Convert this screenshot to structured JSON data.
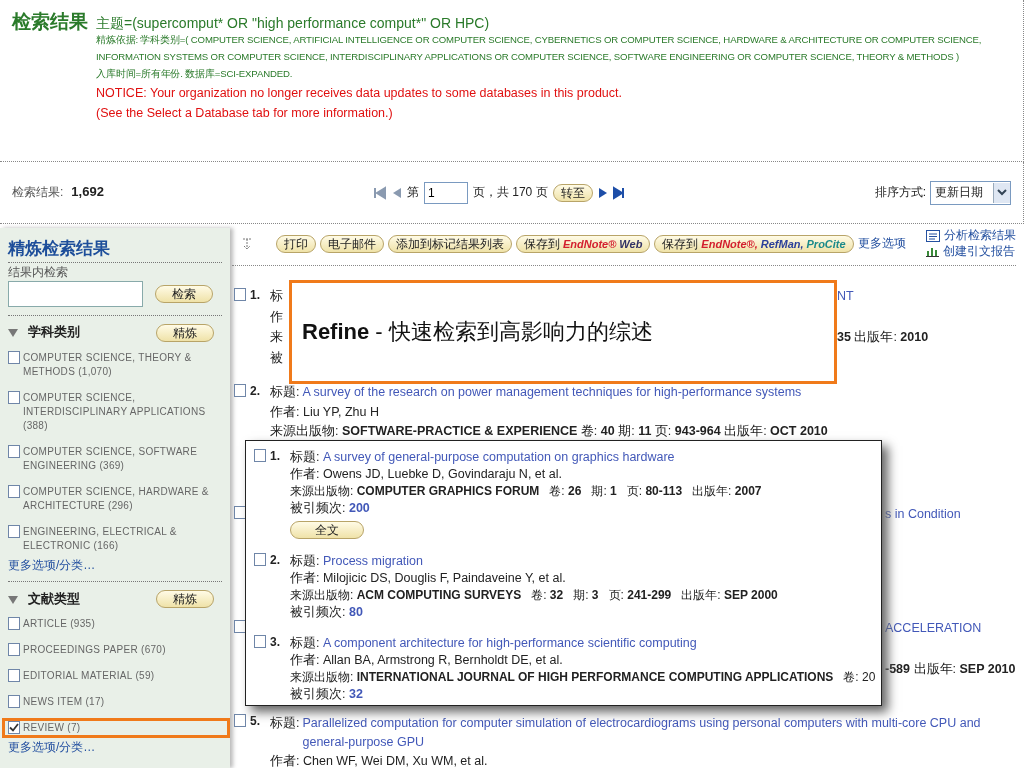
{
  "header": {
    "title": "检索结果",
    "query": "主题=(supercomput* OR \"high performance comput*\" OR HPC)",
    "refine_by": "精炼依据: 学科类别=( COMPUTER SCIENCE, ARTIFICIAL INTELLIGENCE OR COMPUTER SCIENCE, CYBERNETICS OR COMPUTER SCIENCE, HARDWARE & ARCHITECTURE OR COMPUTER SCIENCE, INFORMATION SYSTEMS OR COMPUTER SCIENCE, INTERDISCIPLINARY APPLICATIONS OR COMPUTER SCIENCE, SOFTWARE ENGINEERING OR COMPUTER SCIENCE, THEORY & METHODS )",
    "timespan": "入库时间=所有年份. 数据库=SCI-EXPANDED.",
    "notice": [
      "NOTICE: Your organization no longer receives data updates to some databases in this product.",
      "(See the Select a Database tab for more information.)"
    ]
  },
  "results_bar": {
    "label": "检索结果:",
    "count": "1,692",
    "page_prefix": "第",
    "page": "1",
    "page_suffix": "页，共 170 页",
    "go_button": "转至",
    "sort_label": "排序方式:",
    "sort_value": "更新日期"
  },
  "toolbar": {
    "buttons": [
      {
        "label": "打印"
      },
      {
        "label": "电子邮件"
      },
      {
        "label": "添加到标记结果列表"
      },
      {
        "label": "保存到",
        "brand": [
          {
            "text": "EndNote®",
            "color": "#d3202f"
          },
          {
            "text": "Web",
            "color": "#333366"
          }
        ]
      },
      {
        "label": "保存到",
        "brand": [
          {
            "text": "EndNote®,",
            "color": "#d3202f"
          },
          {
            "text": "RefMan,",
            "color": "#2a3f9a"
          },
          {
            "text": "ProCite",
            "color": "#1a8a8a"
          }
        ]
      }
    ],
    "more": "更多选项",
    "links": [
      "分析检索结果",
      "创建引文报告"
    ]
  },
  "sidebar": {
    "title": "精炼检索结果",
    "search_label": "结果内检索",
    "search_button": "检索",
    "facets": [
      {
        "title": "学科类别",
        "expanded": true,
        "refine_button": "精炼",
        "items": [
          {
            "label": "COMPUTER SCIENCE, THEORY & METHODS (1,070)",
            "checked": false,
            "highlighted": false
          },
          {
            "label": "COMPUTER SCIENCE, INTERDISCIPLINARY APPLICATIONS (388)",
            "checked": false,
            "highlighted": false
          },
          {
            "label": "COMPUTER SCIENCE, SOFTWARE ENGINEERING (369)",
            "checked": false,
            "highlighted": false
          },
          {
            "label": "COMPUTER SCIENCE, HARDWARE & ARCHITECTURE (296)",
            "checked": false,
            "highlighted": false
          },
          {
            "label": "ENGINEERING, ELECTRICAL & ELECTRONIC (166)",
            "checked": false,
            "highlighted": false
          }
        ],
        "more": "更多选项/分类…"
      },
      {
        "title": "文献类型",
        "expanded": true,
        "refine_button": "精炼",
        "items": [
          {
            "label": "ARTICLE (935)",
            "checked": false,
            "highlighted": false
          },
          {
            "label": "PROCEEDINGS PAPER (670)",
            "checked": false,
            "highlighted": false
          },
          {
            "label": "EDITORIAL MATERIAL (59)",
            "checked": false,
            "highlighted": false
          },
          {
            "label": "NEWS ITEM (17)",
            "checked": false,
            "highlighted": false
          },
          {
            "label": "REVIEW (7)",
            "checked": true,
            "highlighted": true
          }
        ],
        "more": "更多选项/分类…"
      }
    ]
  },
  "results": [
    {
      "number": "1.",
      "checked": false,
      "lines": [
        {
          "left": "标",
          "right_link": "NT"
        },
        {
          "left": "作"
        },
        {
          "left": "来",
          "right": "**35** 出版年: **2010**"
        },
        {
          "left": "被"
        }
      ]
    },
    {
      "number": "2.",
      "checked": false,
      "lines": [
        {
          "left": "标题:",
          "link": "A survey of the research on power management techniques for high-performance systems"
        },
        {
          "left": "作者: Liu YP, Zhu H"
        },
        {
          "left": "来源出版物: **SOFTWARE-PRACTICE & EXPERIENCE** 卷: **40** 期: **11** 页: **943-964** 出版年: **OCT 2010**"
        }
      ]
    },
    {
      "checked": false,
      "lines": [
        {
          "right_link": "s in Condition"
        }
      ]
    },
    {
      "checked": false,
      "lines": [
        {
          "right_link": "ACCELERATION"
        },
        {
          "right": "**-589** 出版年: **SEP 2010**"
        }
      ]
    },
    {
      "number": "5.",
      "checked": false,
      "lines": [
        {
          "left": "标题:",
          "link": "Parallelized computation for computer simulation of electrocardiograms using personal computers with multi-core CPU and general-purpose GPU"
        },
        {
          "left": "作者: Chen WF, Wei DM, Xu WM, et al."
        }
      ]
    }
  ],
  "callout": {
    "text": "**Refine** - 快速检索到高影响力的综述"
  },
  "popup": {
    "records": [
      {
        "number": "1.",
        "checked": false,
        "title_label": "标题:",
        "title": "A survey of general-purpose computation on graphics hardware",
        "authors": "作者: Owens JD, Luebke D, Govindaraju N, et al.",
        "source": "来源出版物: **COMPUTER GRAPHICS FORUM**   卷: **26**   期: **1**   页: **80-113**   出版年: **2007**",
        "cited_label": "被引频次:",
        "cited": "200",
        "fulltext": "全文"
      },
      {
        "number": "2.",
        "checked": false,
        "title_label": "标题:",
        "title": "Process migration",
        "authors": "作者: Milojicic DS, Douglis F, Paindaveine Y, et al.",
        "source": "来源出版物: **ACM COMPUTING SURVEYS**   卷: **32**   期: **3**   页: **241-299**   出版年: **SEP 2000**",
        "cited_label": "被引频次:",
        "cited": "80"
      },
      {
        "number": "3.",
        "checked": false,
        "title_label": "标题:",
        "title": "A component architecture for high-performance scientific computing",
        "authors": "作者: Allan BA, Armstrong R, Bernholdt DE, et al.",
        "source": "来源出版物: **INTERNATIONAL JOURNAL OF HIGH PERFORMANCE COMPUTING APPLICATIONS**   卷: 20",
        "cited_label": "被引频次:",
        "cited": "32"
      }
    ]
  }
}
